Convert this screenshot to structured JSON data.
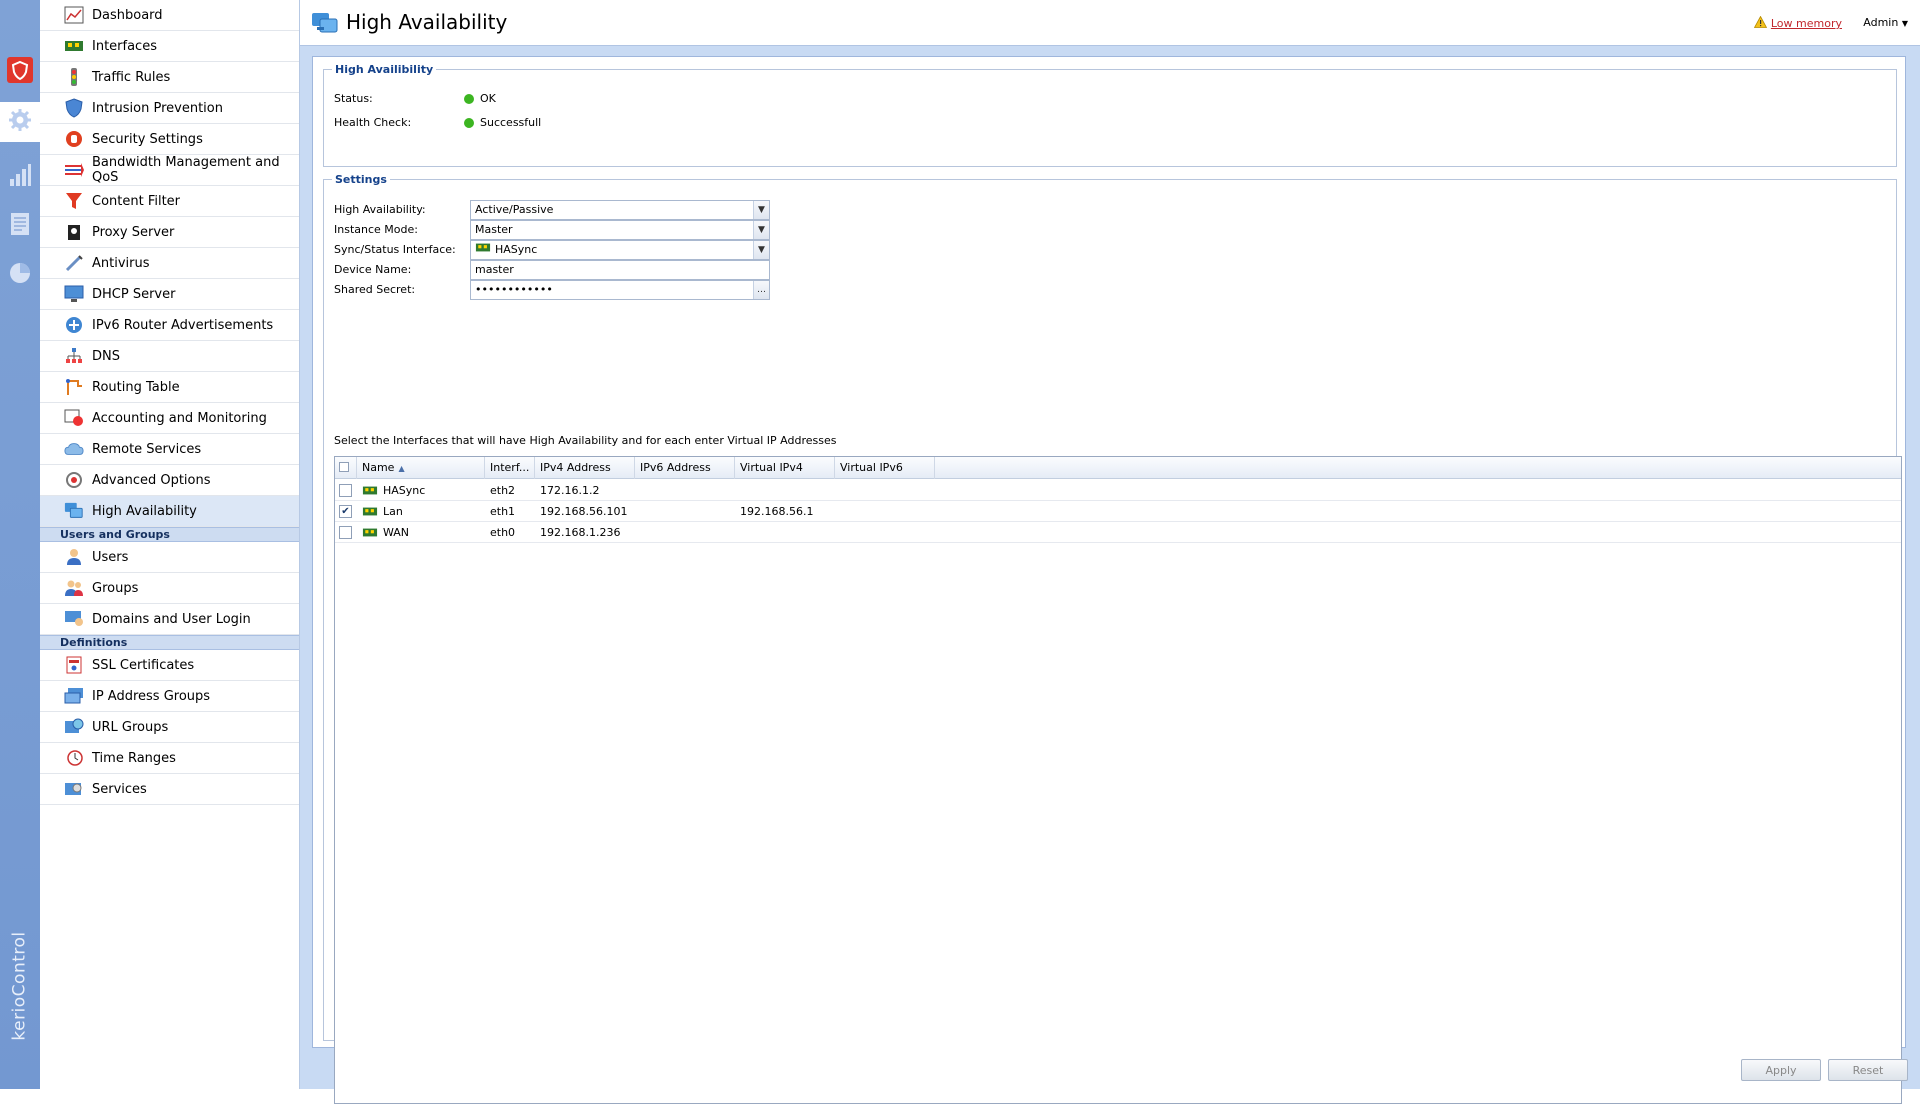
{
  "app": {
    "brand": "kerioControl"
  },
  "rail": {
    "icons": [
      "shield-icon",
      "gear-icon",
      "chart-icon",
      "document-icon",
      "pie-icon"
    ]
  },
  "nav": {
    "config_items": [
      {
        "label": "Dashboard",
        "icon": "dashboard-icon"
      },
      {
        "label": "Interfaces",
        "icon": "interface-icon"
      },
      {
        "label": "Traffic Rules",
        "icon": "traffic-icon"
      },
      {
        "label": "Intrusion Prevention",
        "icon": "shield-icon"
      },
      {
        "label": "Security Settings",
        "icon": "hand-icon"
      },
      {
        "label": "Bandwidth Management and QoS",
        "icon": "arrows-icon"
      },
      {
        "label": "Content Filter",
        "icon": "funnel-icon"
      },
      {
        "label": "Proxy Server",
        "icon": "proxy-icon"
      },
      {
        "label": "Antivirus",
        "icon": "syringe-icon"
      },
      {
        "label": "DHCP Server",
        "icon": "monitor-icon"
      },
      {
        "label": "IPv6 Router Advertisements",
        "icon": "router-icon"
      },
      {
        "label": "DNS",
        "icon": "tree-icon"
      },
      {
        "label": "Routing Table",
        "icon": "routing-icon"
      },
      {
        "label": "Accounting and Monitoring",
        "icon": "accounting-icon"
      },
      {
        "label": "Remote Services",
        "icon": "cloud-icon"
      },
      {
        "label": "Advanced Options",
        "icon": "tools-icon"
      },
      {
        "label": "High Availability",
        "icon": "ha-icon",
        "selected": true
      }
    ],
    "sections": [
      {
        "title": "Users and Groups",
        "items": [
          {
            "label": "Users",
            "icon": "user-icon"
          },
          {
            "label": "Groups",
            "icon": "group-icon"
          },
          {
            "label": "Domains and User Login",
            "icon": "domain-icon"
          }
        ]
      },
      {
        "title": "Definitions",
        "items": [
          {
            "label": "SSL Certificates",
            "icon": "certificate-icon"
          },
          {
            "label": "IP Address Groups",
            "icon": "ip-group-icon"
          },
          {
            "label": "URL Groups",
            "icon": "url-icon"
          },
          {
            "label": "Time Ranges",
            "icon": "clock-icon"
          },
          {
            "label": "Services",
            "icon": "services-icon"
          }
        ]
      }
    ]
  },
  "header": {
    "title": "High Availability",
    "low_memory": "Low memory",
    "user_menu": "Admin"
  },
  "status_box": {
    "legend": "High Availibility",
    "status_label": "Status:",
    "status_value": "OK",
    "health_label": "Health Check:",
    "health_value": "Successfull"
  },
  "settings": {
    "legend": "Settings",
    "fields": [
      {
        "label": "High Availability:",
        "value": "Active/Passive",
        "type": "combo"
      },
      {
        "label": "Instance Mode:",
        "value": "Master",
        "type": "combo"
      },
      {
        "label": "Sync/Status Interface:",
        "value": "HASync",
        "type": "combo",
        "icon": true
      },
      {
        "label": "Device Name:",
        "value": "master",
        "type": "text"
      },
      {
        "label": "Shared Secret:",
        "value": "••••••••••••",
        "type": "password"
      }
    ],
    "instruction": "Select the Interfaces that will have High Availability and for each enter Virtual IP Addresses"
  },
  "table": {
    "columns": [
      "Name",
      "Interf...",
      "IPv4 Address",
      "IPv6 Address",
      "Virtual IPv4",
      "Virtual IPv6"
    ],
    "rows": [
      {
        "checked": false,
        "name": "HASync",
        "interface": "eth2",
        "ipv4": "172.16.1.2",
        "ipv6": "",
        "vipv4": "",
        "vipv6": ""
      },
      {
        "checked": true,
        "name": "Lan",
        "interface": "eth1",
        "ipv4": "192.168.56.101",
        "ipv6": "",
        "vipv4": "192.168.56.1",
        "vipv6": ""
      },
      {
        "checked": false,
        "name": "WAN",
        "interface": "eth0",
        "ipv4": "192.168.1.236",
        "ipv6": "",
        "vipv4": "",
        "vipv6": ""
      }
    ]
  },
  "buttons": {
    "apply": "Apply",
    "reset": "Reset"
  },
  "colors": {
    "accent": "#15428b",
    "rail": "#7398d1",
    "ok": "#3cb521",
    "warning": "#c1272d"
  }
}
